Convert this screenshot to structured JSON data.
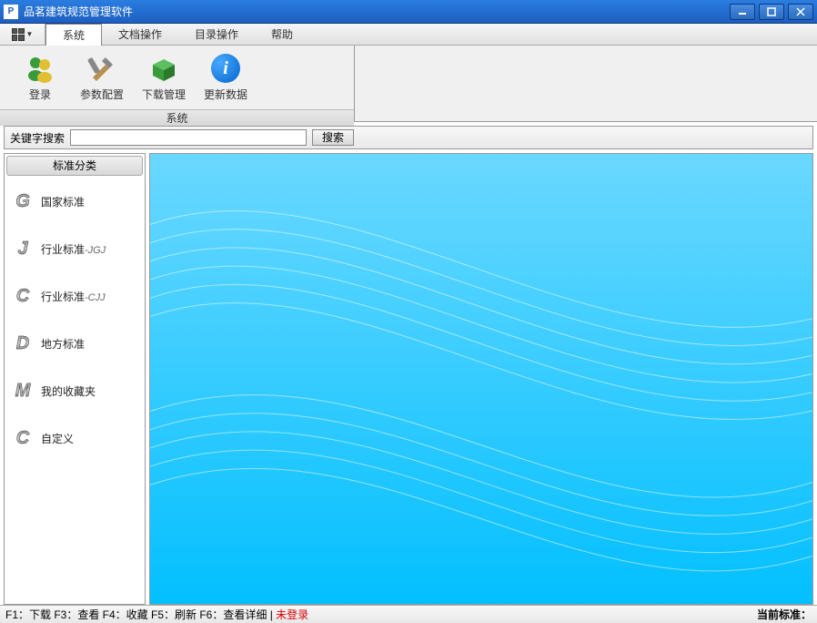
{
  "window": {
    "title": "品茗建筑规范管理软件"
  },
  "menubar": {
    "items": [
      {
        "label": "系统",
        "active": true
      },
      {
        "label": "文档操作",
        "active": false
      },
      {
        "label": "目录操作",
        "active": false
      },
      {
        "label": "帮助",
        "active": false
      }
    ]
  },
  "toolbar": {
    "group_label": "系统",
    "buttons": [
      {
        "label": "登录",
        "icon": "people-icon"
      },
      {
        "label": "参数配置",
        "icon": "tools-icon"
      },
      {
        "label": "下载管理",
        "icon": "box-icon"
      },
      {
        "label": "更新数据",
        "icon": "info-icon"
      }
    ]
  },
  "search": {
    "label": "关键字搜索",
    "placeholder": "",
    "button_label": "搜索"
  },
  "sidebar": {
    "header": "标准分类",
    "items": [
      {
        "letter": "G",
        "label": "国家标准",
        "suffix": ""
      },
      {
        "letter": "J",
        "label": "行业标准",
        "suffix": "-JGJ"
      },
      {
        "letter": "C",
        "label": "行业标准",
        "suffix": "-CJJ"
      },
      {
        "letter": "D",
        "label": "地方标准",
        "suffix": ""
      },
      {
        "letter": "M",
        "label": "我的收藏夹",
        "suffix": ""
      },
      {
        "letter": "C",
        "label": "自定义",
        "suffix": ""
      }
    ]
  },
  "statusbar": {
    "hints": "F1：下载 F3：查看 F4：收藏 F5：刷新 F6：查看详细 |",
    "not_logged": "未登录",
    "current_label": "当前标准："
  }
}
